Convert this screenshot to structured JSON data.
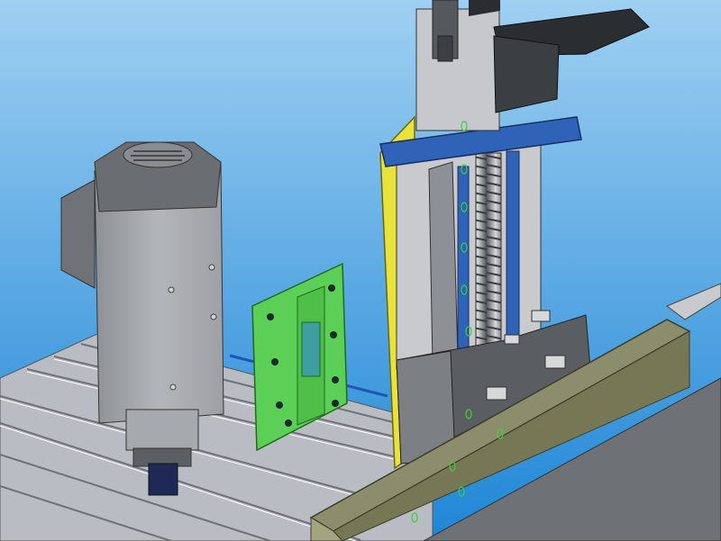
{
  "viewport": {
    "background_top": "#9fd0f2",
    "background_bottom": "#1e86d6"
  },
  "parts": {
    "spindle_motor": "spindle-motor",
    "mounting_plate": "mounting-plate",
    "z_axis_assembly": "z-axis-assembly",
    "linear_rail": "linear-rail",
    "ball_screw": "ball-screw",
    "carriage_block": "carriage-block",
    "gantry_beam": "gantry-beam",
    "slotted_table": "slotted-table"
  },
  "colors": {
    "motor_gray": "#a9acb0",
    "motor_dark": "#5e6266",
    "plate_green": "#5ccf57",
    "yellow_plate": "#e8e23a",
    "blue_plate": "#2f63b8",
    "table_gray": "#b9bcc2",
    "beam_olive": "#8c8d6c"
  }
}
